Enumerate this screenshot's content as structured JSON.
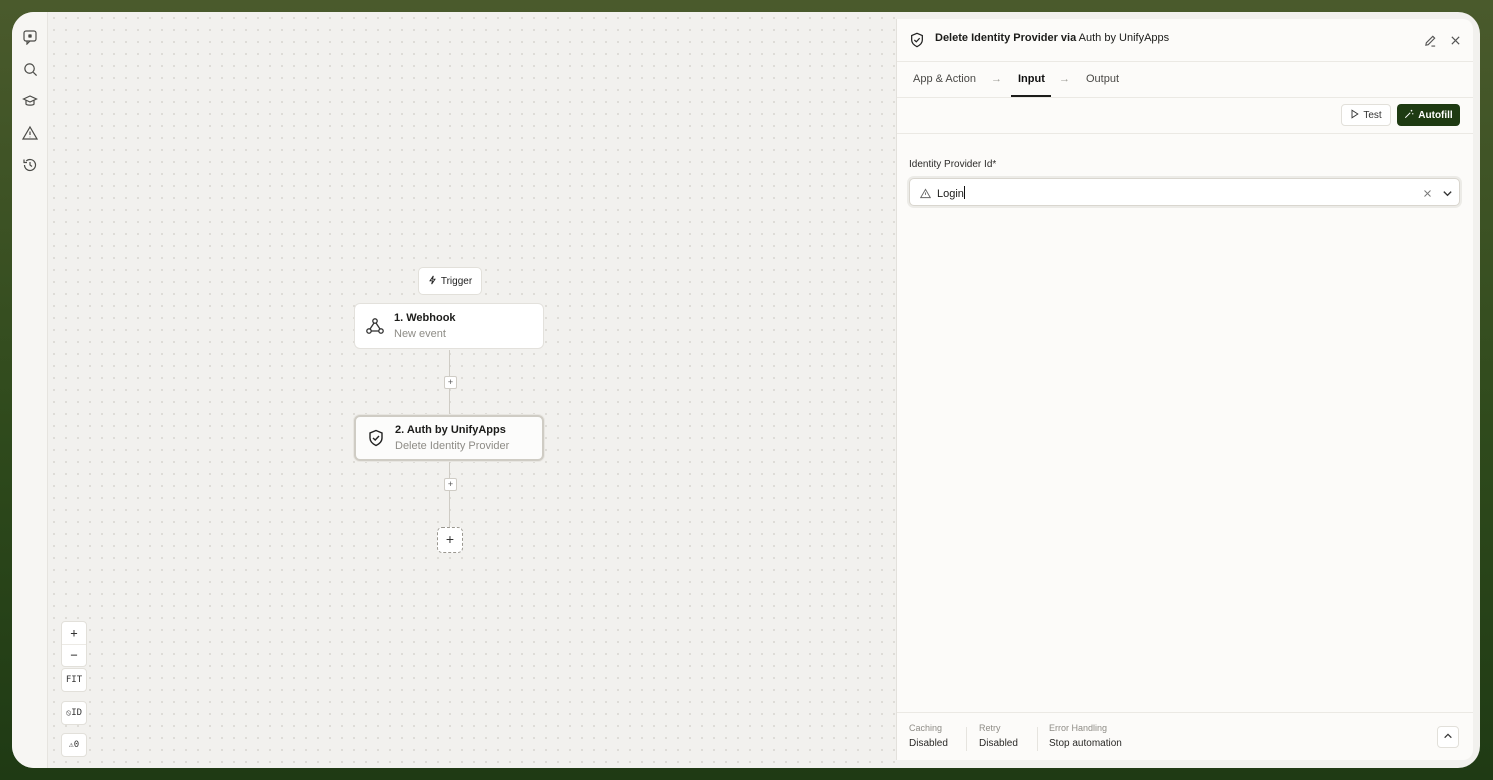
{
  "rail": {
    "icons": [
      "chat-icon",
      "search-icon",
      "graduation-cap-icon",
      "warning-icon",
      "history-icon"
    ]
  },
  "canvas": {
    "trigger_label": "Trigger",
    "nodes": [
      {
        "title": "1. Webhook",
        "subtitle": "New event",
        "icon": "webhook-icon"
      },
      {
        "title": "2. Auth by UnifyApps",
        "subtitle": "Delete Identity Provider",
        "icon": "shield-check-icon"
      }
    ],
    "add_step_symbol": "+",
    "zoom": {
      "in": "+",
      "out": "−",
      "fit": "FIT",
      "id_toggle": "ID",
      "warnings_count": "0"
    }
  },
  "panel": {
    "title_action": "Delete Identity Provider via",
    "title_app": "Auth by UnifyApps",
    "tabs": [
      {
        "label": "App & Action"
      },
      {
        "label": "Input",
        "active": true
      },
      {
        "label": "Output"
      }
    ],
    "test_label": "Test",
    "autofill_label": "Autofill",
    "field_label": "Identity Provider Id*",
    "field_value": "Login",
    "footer": [
      {
        "label": "Caching",
        "value": "Disabled"
      },
      {
        "label": "Retry",
        "value": "Disabled"
      },
      {
        "label": "Error Handling",
        "value": "Stop automation"
      }
    ]
  },
  "colors": {
    "accent": "#1e3a12",
    "frame": "#2f4a1c",
    "canvas": "#f2f1ee"
  }
}
